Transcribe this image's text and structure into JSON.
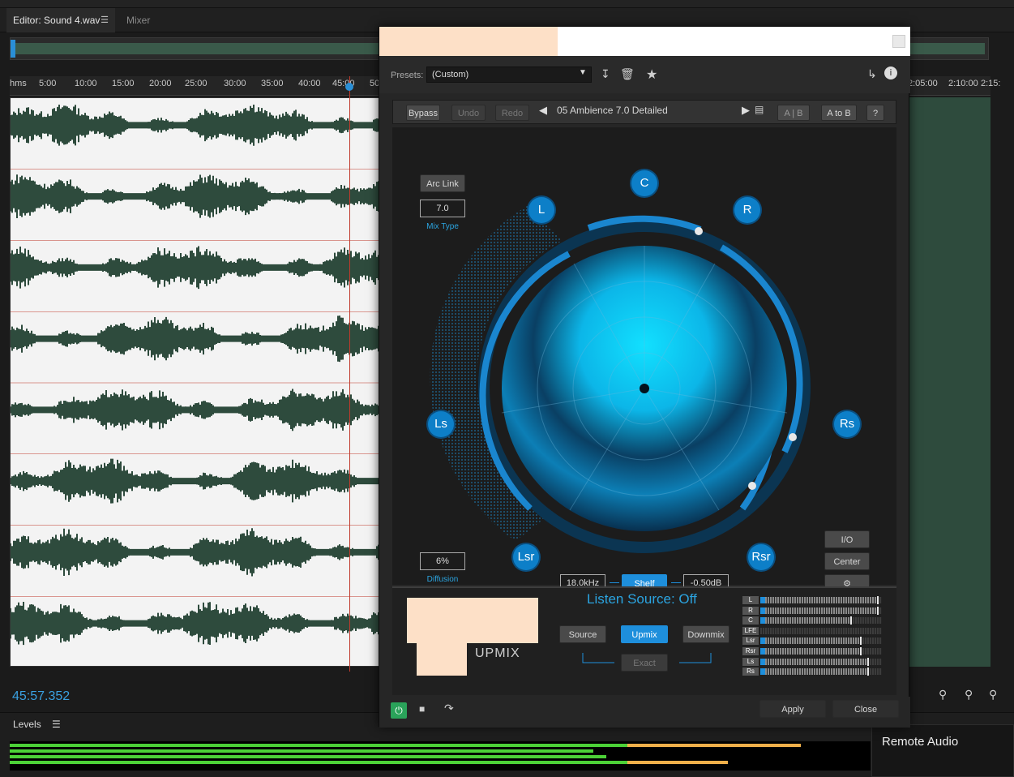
{
  "host": {
    "tabs": [
      {
        "label": "Editor: Sound 4.wav"
      },
      {
        "label": "Mixer"
      }
    ],
    "tab_menu_icon": "hamburger-icon",
    "ruler_ticks": [
      "hms",
      "5:00",
      "10:00",
      "15:00",
      "20:00",
      "25:00",
      "30:00",
      "35:00",
      "40:00",
      "45:00",
      "50",
      "2:05:00",
      "2:10:00",
      "2:15:"
    ],
    "timecode": "45:57.352",
    "levels_title": "Levels",
    "remote_audio": "Remote Audio",
    "colors": {
      "accent": "#2a8fd6",
      "wave": "#2e4b3d",
      "meter_green": "#4cd137",
      "meter_orange": "#f0b04a"
    }
  },
  "plugin": {
    "presets_label": "Presets:",
    "preset_value": "(Custom)",
    "toolbar": {
      "bypass": "Bypass",
      "undo": "Undo",
      "redo": "Redo",
      "preset_name": "05 Ambience 7.0 Detailed",
      "ab": "A | B",
      "a_to_b": "A to B",
      "help": "?"
    },
    "arc_link": "Arc Link",
    "mix_type_value": "7.0",
    "mix_type_label": "Mix Type",
    "diffusion_value": "6%",
    "diffusion_label": "Diffusion",
    "speakers": {
      "C": "C",
      "L": "L",
      "R": "R",
      "Ls": "Ls",
      "Rs": "Rs",
      "Lsr": "Lsr",
      "Rsr": "Rsr"
    },
    "filter": {
      "freq": "18.0kHz",
      "type": "Shelf",
      "gain": "-0.50dB"
    },
    "side_buttons": {
      "io": "I/O",
      "center": "Center"
    },
    "listen_source": "Listen Source: Off",
    "mode_buttons": {
      "source": "Source",
      "upmix": "Upmix",
      "downmix": "Downmix",
      "exact": "Exact"
    },
    "logo_text": "UPMIX",
    "meters": [
      {
        "label": "L",
        "level": 0.05,
        "peak": 0.96
      },
      {
        "label": "R",
        "level": 0.05,
        "peak": 0.96
      },
      {
        "label": "C",
        "level": 0.05,
        "peak": 0.74
      },
      {
        "label": "LFE",
        "level": 0.0,
        "peak": 0.0
      },
      {
        "label": "Lsr",
        "level": 0.05,
        "peak": 0.82
      },
      {
        "label": "Rsr",
        "level": 0.05,
        "peak": 0.82
      },
      {
        "label": "Ls",
        "level": 0.05,
        "peak": 0.88
      },
      {
        "label": "Rs",
        "level": 0.05,
        "peak": 0.88
      }
    ],
    "footer": {
      "apply": "Apply",
      "close": "Close"
    },
    "colors": {
      "accent": "#1e8fdc",
      "speaker": "#0d7fc8"
    }
  }
}
